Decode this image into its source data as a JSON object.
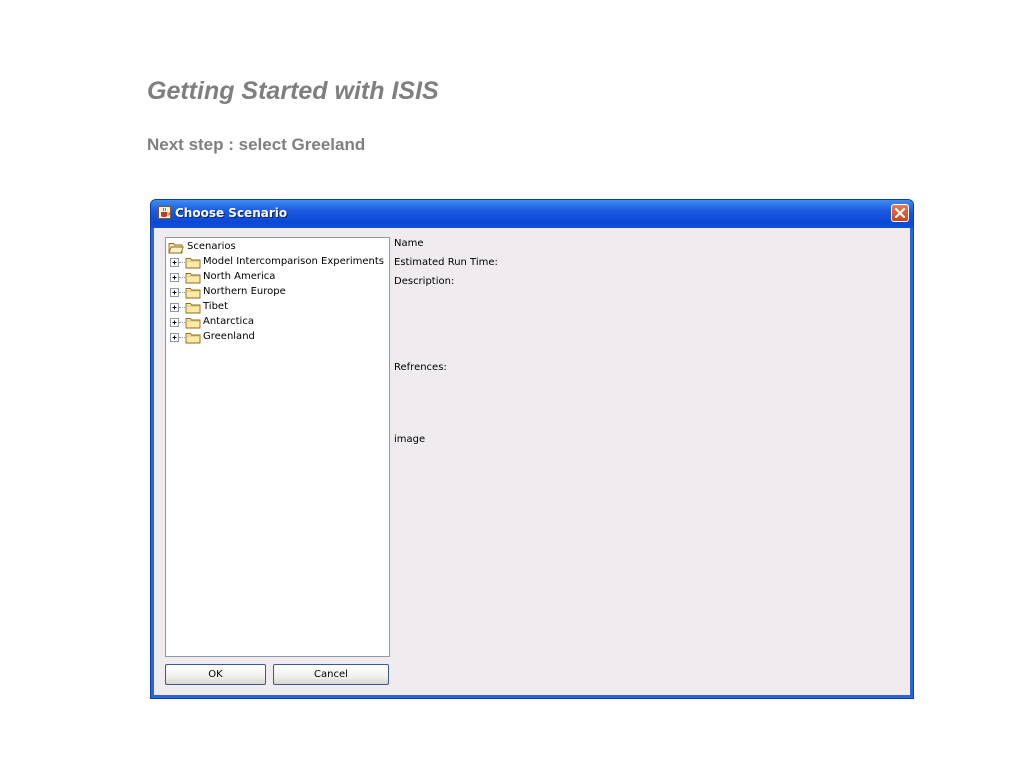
{
  "slide": {
    "title": "Getting Started with ISIS",
    "subtitle": "Next step : select Greeland"
  },
  "window": {
    "title": "Choose Scenario",
    "icon": "java-cup-icon",
    "close_icon": "close-icon"
  },
  "tree": {
    "root": {
      "label": "Scenarios",
      "icon": "folder-open-icon"
    },
    "items": [
      {
        "label": "Model Intercomparison Experiments",
        "icon": "folder-icon",
        "expander": "+"
      },
      {
        "label": "North America",
        "icon": "folder-icon",
        "expander": "+"
      },
      {
        "label": "Northern Europe",
        "icon": "folder-icon",
        "expander": "+"
      },
      {
        "label": "Tibet",
        "icon": "folder-icon",
        "expander": "+"
      },
      {
        "label": "Antarctica",
        "icon": "folder-icon",
        "expander": "+"
      },
      {
        "label": "Greenland",
        "icon": "folder-icon",
        "expander": "+"
      }
    ]
  },
  "details": {
    "name_label": "Name",
    "run_time_label": "Estimated Run Time:",
    "description_label": "Description:",
    "references_label": "Refrences:",
    "image_label": "image"
  },
  "buttons": {
    "ok": "OK",
    "cancel": "Cancel"
  },
  "colors": {
    "titlebar": "#0b48d6",
    "client": "#efebef",
    "slide_text": "#7f7f7f"
  }
}
